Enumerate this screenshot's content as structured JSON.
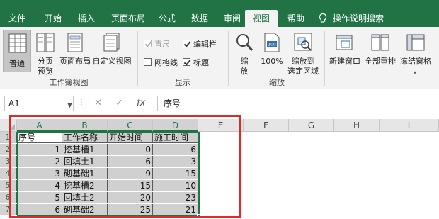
{
  "colors": {
    "brand": "#217346",
    "highlight_frame": "#e02a2a",
    "selection_fill": "#d0d0d0"
  },
  "tabs": [
    {
      "label": "文件",
      "active": false
    },
    {
      "label": "开始",
      "active": false
    },
    {
      "label": "插入",
      "active": false
    },
    {
      "label": "页面布局",
      "active": false
    },
    {
      "label": "公式",
      "active": false
    },
    {
      "label": "数据",
      "active": false
    },
    {
      "label": "审阅",
      "active": false
    },
    {
      "label": "视图",
      "active": true
    },
    {
      "label": "帮助",
      "active": false
    }
  ],
  "tell_me": {
    "label": "操作说明搜索",
    "icon": "lightbulb-icon"
  },
  "ribbon": {
    "workbook_views": {
      "group_label": "工作簿视图",
      "normal": {
        "label": "普通",
        "icon": "normal-view-icon"
      },
      "page_break": {
        "line1": "分页",
        "line2": "预览",
        "icon": "page-break-preview-icon"
      },
      "page_layout": {
        "label": "页面布局",
        "icon": "page-layout-icon"
      },
      "custom_views": {
        "label": "自定义视图",
        "icon": "custom-views-icon"
      }
    },
    "show": {
      "group_label": "显示",
      "ruler": {
        "label": "直尺",
        "checked": true,
        "enabled": false
      },
      "formula_bar": {
        "label": "编辑栏",
        "checked": true,
        "enabled": true
      },
      "gridlines": {
        "label": "网格线",
        "checked": false,
        "enabled": true
      },
      "headings": {
        "label": "标题",
        "checked": true,
        "enabled": true
      }
    },
    "zoom": {
      "group_label": "缩放",
      "zoom": {
        "line1": "缩",
        "line2": "放",
        "icon": "magnifier-icon"
      },
      "zoom_100": {
        "label": "100%",
        "icon": "zoom-100-icon"
      },
      "zoom_selection": {
        "line1": "缩放到",
        "line2": "选定区域",
        "icon": "zoom-to-selection-icon"
      }
    },
    "window": {
      "new_window": {
        "label": "新建窗口",
        "icon": "new-window-icon"
      },
      "arrange_all": {
        "label": "全部重排",
        "icon": "arrange-all-icon"
      },
      "freeze_panes": {
        "label": "冻结窗格",
        "icon": "freeze-panes-icon"
      }
    }
  },
  "formula_bar": {
    "name_box": "A1",
    "cancel_glyph": "✕",
    "enter_glyph": "✓",
    "fx_glyph": "fx",
    "content": "序号"
  },
  "sheet": {
    "columns": [
      "A",
      "B",
      "C",
      "D",
      "E",
      "F",
      "G",
      "H",
      "I"
    ],
    "selected_columns": [
      "A",
      "B",
      "C",
      "D"
    ],
    "rows": [
      "1",
      "2",
      "3",
      "4",
      "5",
      "6",
      "7"
    ],
    "header_row": [
      "序号",
      "工作名称",
      "开始时间",
      "施工时间"
    ],
    "data_rows": [
      [
        "1",
        "挖基槽1",
        "0",
        "6"
      ],
      [
        "2",
        "回填土1",
        "6",
        "3"
      ],
      [
        "3",
        "砌基础1",
        "9",
        "15"
      ],
      [
        "4",
        "挖基槽2",
        "15",
        "10"
      ],
      [
        "5",
        "回填土2",
        "20",
        "23"
      ],
      [
        "6",
        "砌基础2",
        "25",
        "21"
      ]
    ]
  }
}
